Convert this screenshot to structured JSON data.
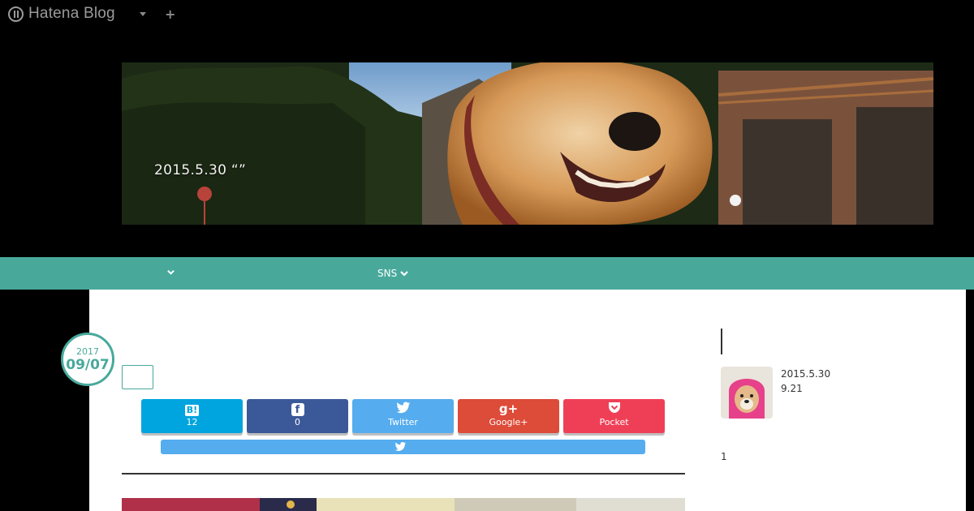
{
  "topbar": {
    "logo_text": "Hatena Blog",
    "logo_icon": "hatena-logo-icon",
    "menu_icon": "caret-down-icon",
    "add_icon": "plus-icon",
    "add_symbol": "+"
  },
  "header": {
    "title": "2015.5.30 “”",
    "background_icon": "shiba-inu-header-photo"
  },
  "nav": {
    "items": [
      {
        "label": "",
        "icon": "chevron-down-icon"
      },
      {
        "label": "SNS",
        "icon": "chevron-down-icon"
      }
    ]
  },
  "post": {
    "date_year": "2017",
    "date_md": "09/07",
    "share_buttons": [
      {
        "name": "hatena-bookmark",
        "icon_text": "B!",
        "label": "12",
        "color": "#00a4de"
      },
      {
        "name": "facebook",
        "icon_text": "f",
        "label": "0",
        "color": "#3b5998"
      },
      {
        "name": "twitter",
        "icon_text": "🐦",
        "label": "Twitter",
        "color": "#55acee"
      },
      {
        "name": "google-plus",
        "icon_text": "g+",
        "label": "Google+",
        "color": "#dd4b39"
      },
      {
        "name": "pocket",
        "icon_text": "❯",
        "label": "Pocket",
        "color": "#ef3f56"
      }
    ],
    "follow_twitter_icon": "twitter-icon"
  },
  "sidebar": {
    "entry": {
      "line1": "2015.5.30",
      "line2": "9.21",
      "thumb_icon": "shiba-inu-thumbnail"
    },
    "count": "1"
  },
  "colors": {
    "accent": "#48a99b",
    "background": "#000000"
  }
}
